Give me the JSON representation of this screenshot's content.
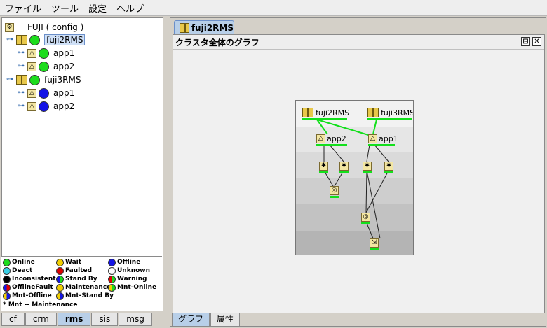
{
  "menu": [
    "ファイル",
    "ツール",
    "設定",
    "ヘルプ"
  ],
  "tree": {
    "root": "FUJI ( config )",
    "nodes": [
      {
        "name": "fuji2RMS",
        "state": "online",
        "apps": [
          {
            "name": "app1",
            "state": "online"
          },
          {
            "name": "app2",
            "state": "online"
          }
        ]
      },
      {
        "name": "fuji3RMS",
        "state": "online",
        "apps": [
          {
            "name": "app1",
            "state": "offline"
          },
          {
            "name": "app2",
            "state": "offline"
          }
        ]
      }
    ]
  },
  "legend": {
    "items": [
      {
        "label": "Online",
        "color": "#1ddc1d"
      },
      {
        "label": "Wait",
        "color": "#f2d000"
      },
      {
        "label": "Offline",
        "color": "#1414e6"
      },
      {
        "label": "Deact",
        "color": "#3ad0e6"
      },
      {
        "label": "Faulted",
        "color": "#e00000"
      },
      {
        "label": "Unknown",
        "color": "#ffffff"
      },
      {
        "label": "Inconsistent",
        "color": "#000000"
      },
      {
        "label": "Stand By",
        "color": "#1ddc1d"
      },
      {
        "label": "Warning",
        "color": "#e04000"
      },
      {
        "label": "OfflineFault",
        "color": "#1414e6"
      },
      {
        "label": "Maintenance",
        "color": "#f2d000"
      },
      {
        "label": "Mnt-Online",
        "color": "#1ddc1d"
      },
      {
        "label": "Mnt-Offline",
        "color": "#1414e6"
      },
      {
        "label": "Mnt-Stand By",
        "color": "#f2d000"
      }
    ],
    "footnote": "* Mnt -- Maintenance"
  },
  "left_tabs": [
    "cf",
    "crm",
    "rms",
    "sis",
    "msg"
  ],
  "left_active_tab": "rms",
  "right_tab": "fuji2RMS",
  "panel_title": "クラスタ全体のグラフ",
  "bottom_tabs": [
    "グラフ",
    "属性"
  ],
  "graph": {
    "nodes": [
      "fuji2RMS",
      "fuji3RMS"
    ],
    "apps": [
      "app2",
      "app1"
    ]
  },
  "colors": {
    "online": "#1ddc1d",
    "offline": "#1414e6",
    "accent": "#b8cfe8"
  }
}
